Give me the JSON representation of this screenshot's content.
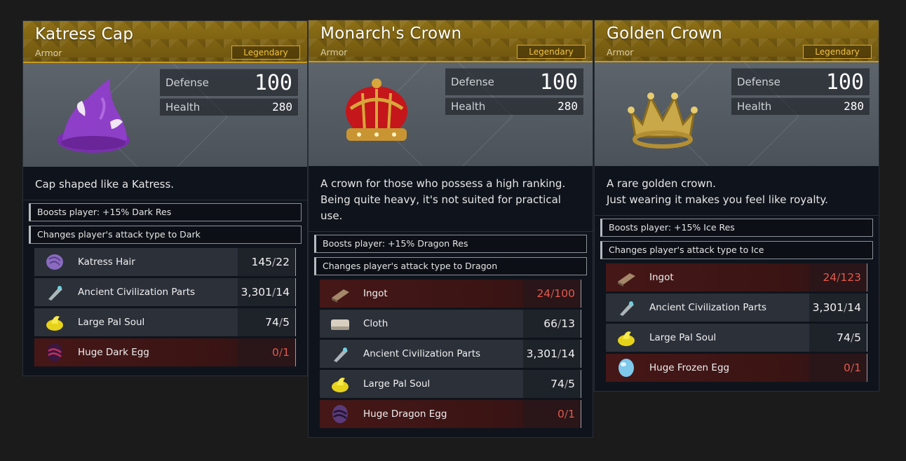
{
  "colors": {
    "header_gold": "#8d6f16",
    "rarity_text": "#f2c440",
    "shortage_red": "#e25a4e",
    "panel_bg": "#0f141c"
  },
  "cards": [
    {
      "name": "Katress Cap",
      "category": "Armor",
      "rarity": "Legendary",
      "icon": "katress-cap-icon",
      "stats": {
        "defense_label": "Defense",
        "defense": "100",
        "health_label": "Health",
        "health": "280"
      },
      "description": "Cap shaped like a Katress.",
      "effects": [
        "Boosts player: +15% Dark Res",
        "Changes player's attack type to Dark"
      ],
      "materials": [
        {
          "name": "Katress Hair",
          "have": "145",
          "need": "22",
          "icon": "katress-hair-icon",
          "short": false
        },
        {
          "name": "Ancient Civilization Parts",
          "have": "3,301",
          "need": "14",
          "icon": "ancient-parts-icon",
          "short": false
        },
        {
          "name": "Large Pal Soul",
          "have": "74",
          "need": "5",
          "icon": "pal-soul-icon",
          "short": false
        },
        {
          "name": "Huge Dark Egg",
          "have": "0",
          "need": "1",
          "icon": "dark-egg-icon",
          "short": true
        }
      ]
    },
    {
      "name": "Monarch's Crown",
      "category": "Armor",
      "rarity": "Legendary",
      "icon": "monarch-crown-icon",
      "stats": {
        "defense_label": "Defense",
        "defense": "100",
        "health_label": "Health",
        "health": "280"
      },
      "description": "A crown for those who possess a high ranking.\nBeing quite heavy, it's not suited for practical\nuse.",
      "effects": [
        "Boosts player: +15% Dragon Res",
        "Changes player's attack type to Dragon"
      ],
      "materials": [
        {
          "name": "Ingot",
          "have": "24",
          "need": "100",
          "icon": "ingot-icon",
          "short": true
        },
        {
          "name": "Cloth",
          "have": "66",
          "need": "13",
          "icon": "cloth-icon",
          "short": false
        },
        {
          "name": "Ancient Civilization Parts",
          "have": "3,301",
          "need": "14",
          "icon": "ancient-parts-icon",
          "short": false
        },
        {
          "name": "Large Pal Soul",
          "have": "74",
          "need": "5",
          "icon": "pal-soul-icon",
          "short": false
        },
        {
          "name": "Huge Dragon Egg",
          "have": "0",
          "need": "1",
          "icon": "dragon-egg-icon",
          "short": true
        }
      ]
    },
    {
      "name": "Golden Crown",
      "category": "Armor",
      "rarity": "Legendary",
      "icon": "golden-crown-icon",
      "stats": {
        "defense_label": "Defense",
        "defense": "100",
        "health_label": "Health",
        "health": "280"
      },
      "description": "A rare golden crown.\nJust wearing it makes you feel like royalty.",
      "effects": [
        "Boosts player: +15% Ice Res",
        "Changes player's attack type to Ice"
      ],
      "materials": [
        {
          "name": "Ingot",
          "have": "24",
          "need": "123",
          "icon": "ingot-icon",
          "short": true
        },
        {
          "name": "Ancient Civilization Parts",
          "have": "3,301",
          "need": "14",
          "icon": "ancient-parts-icon",
          "short": false
        },
        {
          "name": "Large Pal Soul",
          "have": "74",
          "need": "5",
          "icon": "pal-soul-icon",
          "short": false
        },
        {
          "name": "Huge Frozen Egg",
          "have": "0",
          "need": "1",
          "icon": "frozen-egg-icon",
          "short": true
        }
      ]
    }
  ]
}
